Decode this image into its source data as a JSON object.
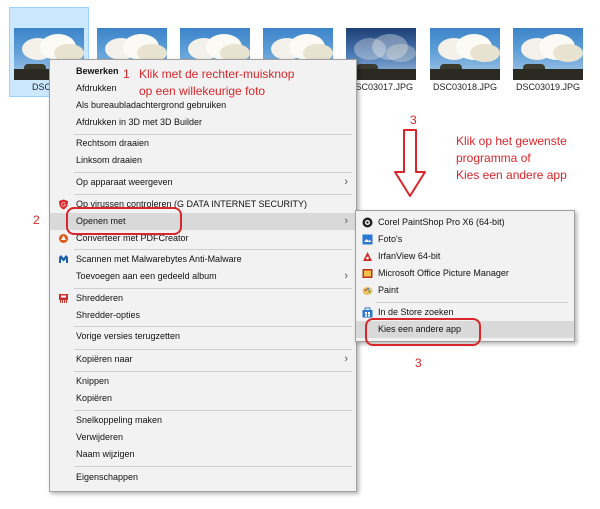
{
  "thumbnails": [
    {
      "label": "DSC030",
      "selected": true
    },
    {
      "label": ""
    },
    {
      "label": ""
    },
    {
      "label": ""
    },
    {
      "label": "DSC03017.JPG",
      "dusk": true
    },
    {
      "label": "DSC03018.JPG"
    },
    {
      "label": "DSC03019.JPG"
    }
  ],
  "context_menu": {
    "edit": "Bewerken",
    "print": "Afdrukken",
    "set_background": "Als bureaubladachtergrond gebruiken",
    "print_3d": "Afdrukken in 3D met 3D Builder",
    "rotate_right": "Rechtsom draaien",
    "rotate_left": "Linksom draaien",
    "cast_device": "Op apparaat weergeven",
    "virus_scan": "Op virussen controleren (G DATA INTERNET SECURITY)",
    "open_with": "Openen met",
    "convert_pdf": "Converteer met PDFCreator",
    "malwarebytes": "Scannen met Malwarebytes Anti-Malware",
    "shared_album": "Toevoegen aan een gedeeld album",
    "shred": "Shredderen",
    "shred_options": "Shredder-opties",
    "restore_versions": "Vorige versies terugzetten",
    "copy_to": "Kopiëren naar",
    "cut": "Knippen",
    "copy": "Kopiëren",
    "create_shortcut": "Snelkoppeling maken",
    "delete": "Verwijderen",
    "rename": "Naam wijzigen",
    "properties": "Eigenschappen"
  },
  "submenu": {
    "corel": "Corel PaintShop Pro X6 (64-bit)",
    "photos": "Foto's",
    "irfanview": "IrfanView 64-bit",
    "ms_picture_manager": "Microsoft Office Picture Manager",
    "paint": "Paint",
    "store_search": "In de Store zoeken",
    "choose_other": "Kies een andere app"
  },
  "annotations": {
    "step1_number": "1",
    "step1_line1": "Klik met de rechter-muisknop",
    "step1_line2": "op een willekeurige foto",
    "step2_number": "2",
    "step3_number_top": "3",
    "step3_line1": "Klik op het gewenste",
    "step3_line2": "programma of",
    "step3_line3": "Kies een andere app",
    "step3_number_bottom": "3",
    "color": "#d9262a"
  }
}
